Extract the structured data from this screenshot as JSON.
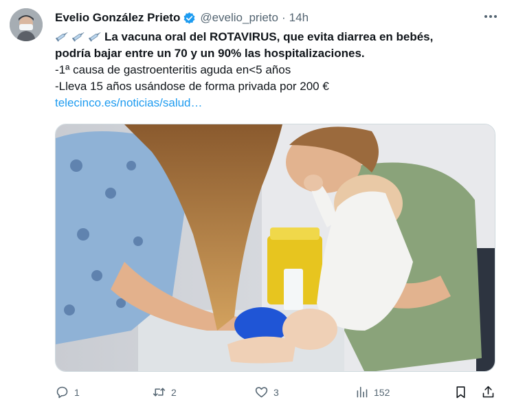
{
  "tweet": {
    "author_name": "Evelio González Prieto",
    "handle": "@evelio_prieto",
    "separator": "·",
    "time": "14h",
    "headline_line1": "La vacuna oral del ROTAVIRUS, que evita diarrea en bebés,",
    "headline_line2": "podría bajar entre un 70 y un 90% las hospitalizaciones.",
    "detail1": "-1ª causa de gastroenteritis aguda en<5 años",
    "detail2": "-Lleva 15 años usándose de forma privada por 200 €",
    "link": "telecinco.es/noticias/salud…"
  },
  "actions": {
    "replies": "1",
    "retweets": "2",
    "likes": "3",
    "views": "152"
  },
  "colors": {
    "accent": "#1d9bf0",
    "secondary_text": "#536471",
    "verified_badge": "#1d9bf0"
  },
  "icons": [
    "syringe-icon",
    "verified-badge-icon",
    "more-icon",
    "reply-icon",
    "retweet-icon",
    "like-icon",
    "views-icon",
    "bookmark-icon",
    "share-icon"
  ]
}
